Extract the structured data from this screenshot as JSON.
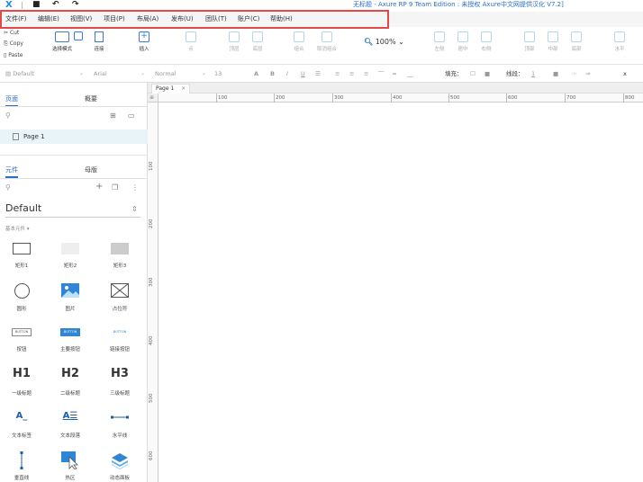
{
  "titlebar": {
    "logo": "X",
    "title": "无标题 - Axure RP 9 Team Edition : 未授权    Axure中文网提供汉化 V7.2]"
  },
  "menu": [
    "文件(F)",
    "编辑(E)",
    "视图(V)",
    "项目(P)",
    "布局(A)",
    "发布(U)",
    "团队(T)",
    "账户(C)",
    "帮助(H)"
  ],
  "clipboard": {
    "cut": "Cut",
    "copy": "Copy",
    "paste": "Paste"
  },
  "toolbar": {
    "select_mode": "选择模式",
    "connect": "连接",
    "insert": "插入",
    "point": "点",
    "top": "顶层",
    "bottom": "底层",
    "group": "组合",
    "ungroup": "取消组合",
    "zoom": "100%",
    "left": "左侧",
    "center": "居中",
    "right": "右侧",
    "top_align": "顶部",
    "middle": "中部",
    "bottom_align": "底部",
    "horizontal": "水平"
  },
  "format": {
    "style": "Default",
    "font": "Arial",
    "weight": "Normal",
    "size": "13",
    "fill_label": "填充：",
    "line_label": "线段：",
    "line_value": "1",
    "x_label": "x"
  },
  "panels": {
    "pages_tab": "页面",
    "outline_tab": "概要",
    "page_item": "Page 1",
    "widgets_tab": "元件",
    "masters_tab": "母版",
    "library": "Default",
    "basic": "基本元件 ▾"
  },
  "widgets": [
    {
      "label": "矩形1"
    },
    {
      "label": "矩形2"
    },
    {
      "label": "矩形3"
    },
    {
      "label": "圆形"
    },
    {
      "label": "图片"
    },
    {
      "label": "占位符"
    },
    {
      "label": "按钮",
      "tag": "BUTTON"
    },
    {
      "label": "主要按钮",
      "tag": "BUTTON"
    },
    {
      "label": "链接按钮",
      "tag": "BUTTON"
    },
    {
      "label": "一级标题",
      "tag": "H1"
    },
    {
      "label": "二级标题",
      "tag": "H2"
    },
    {
      "label": "三级标题",
      "tag": "H3"
    },
    {
      "label": "文本标签",
      "tag": "A_"
    },
    {
      "label": "文本段落",
      "tag": "A"
    },
    {
      "label": "水平线"
    },
    {
      "label": "垂直线"
    },
    {
      "label": "热区"
    },
    {
      "label": "动态面板"
    }
  ],
  "canvas": {
    "tab": "Page 1",
    "tab_close": "×",
    "ruler_h": [
      "100",
      "200",
      "300",
      "400",
      "500",
      "600",
      "700",
      "800"
    ],
    "ruler_v": [
      "100",
      "200",
      "300",
      "400",
      "500",
      "600"
    ]
  },
  "colors": {
    "accent": "#2a6ec8",
    "highlight": "#e24a4a",
    "selected_row": "#e8f4f8"
  }
}
